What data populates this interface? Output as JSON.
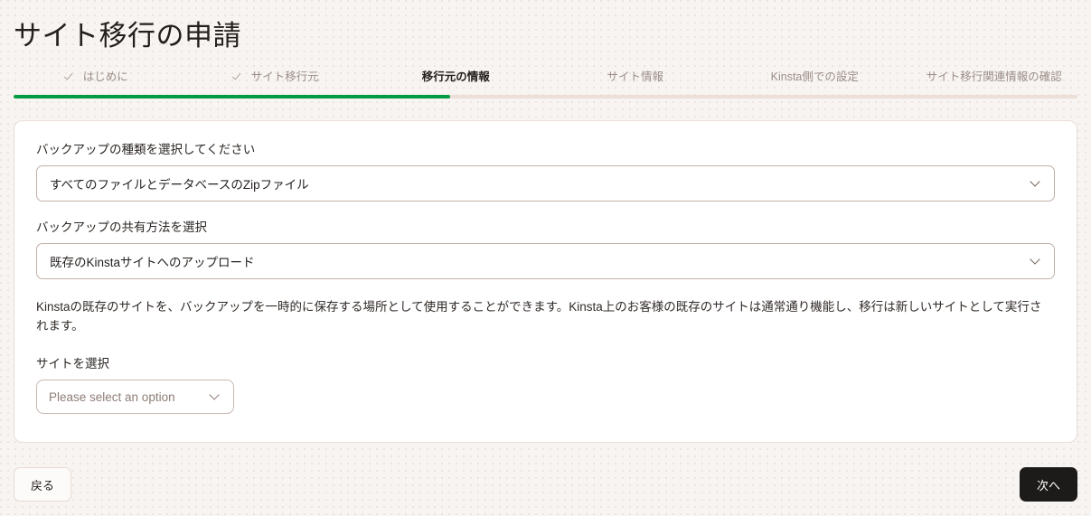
{
  "page": {
    "title": "サイト移行の申請"
  },
  "stepper": {
    "progress_percent": 41,
    "accent_color": "#049b42",
    "track_color": "#ecdfd8",
    "steps": [
      {
        "label": "はじめに",
        "state": "done",
        "icon": "check-icon"
      },
      {
        "label": "サイト移行元",
        "state": "done",
        "icon": "check-icon"
      },
      {
        "label": "移行元の情報",
        "state": "active",
        "icon": ""
      },
      {
        "label": "サイト情報",
        "state": "upcoming",
        "icon": ""
      },
      {
        "label": "Kinsta側での設定",
        "state": "upcoming",
        "icon": ""
      },
      {
        "label": "サイト移行関連情報の確認",
        "state": "upcoming",
        "icon": ""
      }
    ]
  },
  "form": {
    "backup_type": {
      "label": "バックアップの種類を選択してください",
      "value": "すべてのファイルとデータベースのZipファイル",
      "icon": "chevron-down-icon"
    },
    "share_method": {
      "label": "バックアップの共有方法を選択",
      "value": "既存のKinstaサイトへのアップロード",
      "icon": "chevron-down-icon"
    },
    "note": "Kinstaの既存のサイトを、バックアップを一時的に保存する場所として使用することができます。Kinsta上のお客様の既存のサイトは通常通り機能し、移行は新しいサイトとして実行されます。",
    "site_select": {
      "label": "サイトを選択",
      "value": "Please select an option",
      "icon": "chevron-down-icon"
    }
  },
  "footer": {
    "back_label": "戻る",
    "next_label": "次へ"
  }
}
